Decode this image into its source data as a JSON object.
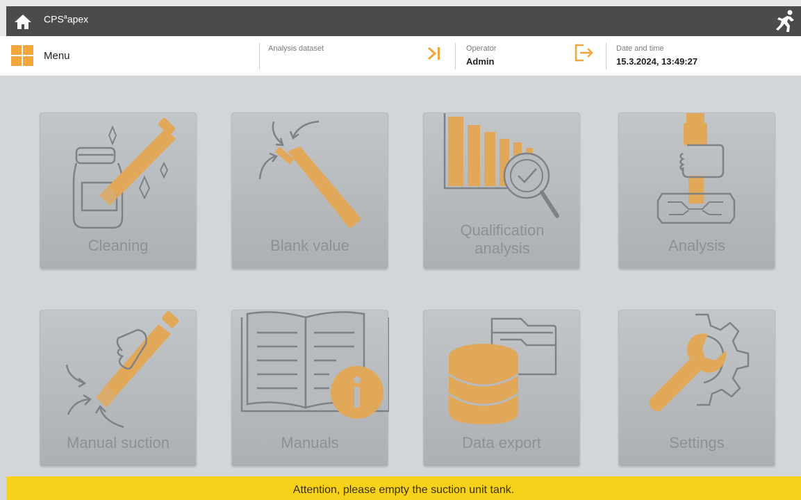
{
  "header": {
    "app_name": "CPS",
    "app_name_sup": "a",
    "app_name_suffix": "apex"
  },
  "toolbar": {
    "menu_label": "Menu",
    "analysis_dataset_label": "Analysis dataset",
    "analysis_dataset_value": "",
    "operator_label": "Operator",
    "operator_value": "Admin",
    "datetime_label": "Date and time",
    "datetime_value": "15.3.2024, 13:49:27"
  },
  "tiles": [
    {
      "label": "Cleaning",
      "icon": "cleaning-icon"
    },
    {
      "label": "Blank value",
      "icon": "blank-value-icon"
    },
    {
      "label": "Qualification analysis",
      "icon": "qualification-analysis-icon"
    },
    {
      "label": "Analysis",
      "icon": "analysis-icon"
    },
    {
      "label": "Manual suction",
      "icon": "manual-suction-icon"
    },
    {
      "label": "Manuals",
      "icon": "manuals-icon"
    },
    {
      "label": "Data export",
      "icon": "data-export-icon"
    },
    {
      "label": "Settings",
      "icon": "settings-icon"
    }
  ],
  "banner": {
    "message": "Attention, please empty the suction unit tank."
  },
  "colors": {
    "accent_orange": "#f0a63a",
    "accent_yellow": "#f7d11a",
    "header_dark": "#4b4b4b",
    "icon_fill": "#e1a85a",
    "icon_stroke": "#7e8286"
  }
}
